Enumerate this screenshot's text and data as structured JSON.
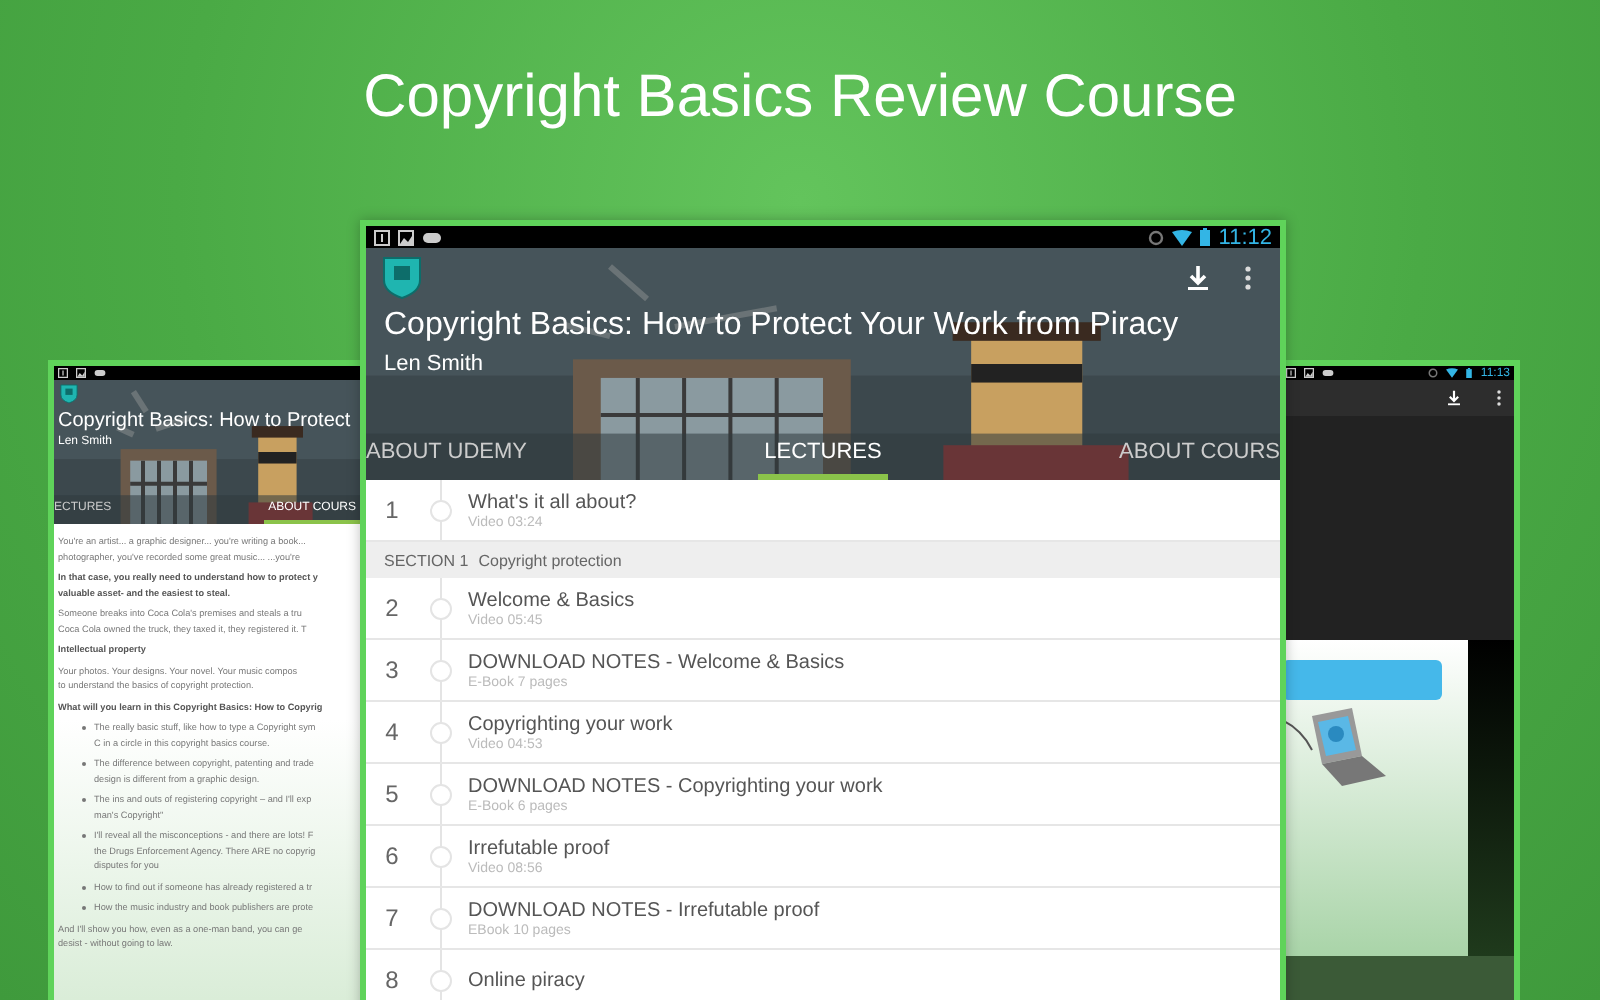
{
  "headline": "Copyright Basics Review Course",
  "left_device": {
    "title": "Copyright Basics: How to Protect",
    "author": "Len Smith",
    "tabs": [
      {
        "label": "ECTURES",
        "selected": false
      },
      {
        "label": "ABOUT COURS",
        "selected": true
      }
    ],
    "description": [
      {
        "kind": "para",
        "lines": [
          "You're an artist... a graphic designer... you're writing a book...",
          "photographer, you've recorded some great music... ...you're"
        ]
      },
      {
        "kind": "bold",
        "lines": [
          "In that case, you really need to understand how to protect y",
          "valuable asset- and the easiest to steal."
        ]
      },
      {
        "kind": "para",
        "lines": [
          "Someone breaks into Coca Cola's premises and steals a tru",
          "Coca Cola owned the truck, they taxed it, they registered it. T"
        ]
      },
      {
        "kind": "bold",
        "lines": [
          "Intellectual property"
        ]
      },
      {
        "kind": "para",
        "lines": [
          "Your photos. Your designs. Your novel. Your music compos",
          "to understand the basics of copyright protection."
        ]
      },
      {
        "kind": "bold",
        "lines": [
          "What will you learn in this Copyright Basics: How to Copyrig"
        ]
      },
      {
        "kind": "bullet",
        "lines": [
          "The really basic stuff, like how to type a Copyright sym",
          "C in a circle in this copyright basics course."
        ]
      },
      {
        "kind": "bullet",
        "lines": [
          "The difference between copyright, patenting and trade",
          "design is different from a graphic design."
        ]
      },
      {
        "kind": "bullet",
        "lines": [
          "The ins and outs of registering copyright – and I'll exp",
          "man's Copyright\""
        ]
      },
      {
        "kind": "bullet",
        "lines": [
          "I'll reveal all the misconceptions - and there are lots! F",
          "the Drugs Enforcement Agency. There ARE no copyrig",
          "disputes for you"
        ]
      },
      {
        "kind": "bullet",
        "lines": [
          "How to find out if someone has already registered a tr"
        ]
      },
      {
        "kind": "bullet",
        "lines": [
          "How the music industry and book publishers are prote"
        ]
      },
      {
        "kind": "para",
        "lines": [
          "And I'll show you how, even as a one-man band, you can ge",
          "desist - without going to law."
        ]
      }
    ]
  },
  "center_device": {
    "status_bar": {
      "time": "11:12"
    },
    "title": "Copyright Basics: How to Protect Your Work from Piracy",
    "author": "Len Smith",
    "tabs": [
      {
        "label": "ABOUT UDEMY",
        "selected": false
      },
      {
        "label": "LECTURES",
        "selected": true
      },
      {
        "label": "ABOUT COURS",
        "selected": false
      }
    ],
    "items": [
      {
        "kind": "lecture",
        "number": "1",
        "title": "What's it all about?",
        "subtitle": "Video 03:24"
      },
      {
        "kind": "section",
        "label": "SECTION 1",
        "title": "Copyright protection"
      },
      {
        "kind": "lecture",
        "number": "2",
        "title": "Welcome & Basics",
        "subtitle": "Video 05:45"
      },
      {
        "kind": "lecture",
        "number": "3",
        "title": "DOWNLOAD NOTES - Welcome & Basics",
        "subtitle": "E-Book 7 pages"
      },
      {
        "kind": "lecture",
        "number": "4",
        "title": "Copyrighting your work",
        "subtitle": "Video 04:53"
      },
      {
        "kind": "lecture",
        "number": "5",
        "title": "DOWNLOAD NOTES - Copyrighting your work",
        "subtitle": "E-Book 6 pages"
      },
      {
        "kind": "lecture",
        "number": "6",
        "title": "Irrefutable proof",
        "subtitle": "Video 08:56"
      },
      {
        "kind": "lecture",
        "number": "7",
        "title": "DOWNLOAD NOTES - Irrefutable proof",
        "subtitle": "EBook 10 pages"
      },
      {
        "kind": "lecture",
        "number": "8",
        "title": "Online piracy"
      }
    ]
  },
  "right_device": {
    "status_bar": {
      "time": "11:13"
    }
  }
}
